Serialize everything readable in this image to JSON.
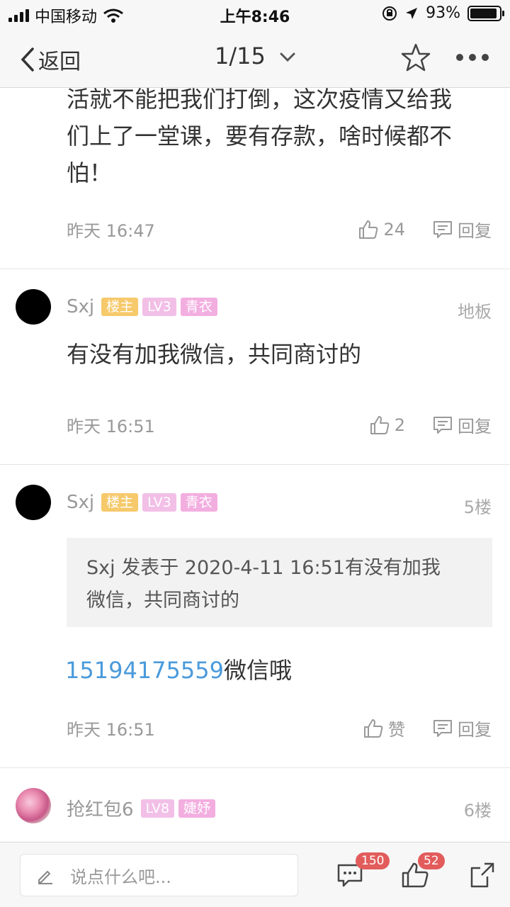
{
  "status_bar": {
    "carrier": "中国移动",
    "time": "上午8:46",
    "battery": "93%",
    "battery_level": 0.93
  },
  "nav": {
    "back_label": "返回",
    "page_indicator": "1/15"
  },
  "posts": [
    {
      "text_lines": [
        "活就不能把我们打倒，这次疫情又给我",
        "们上了一堂课，要有存款，啥时候都不",
        "怕！"
      ],
      "time": "昨天 16:47",
      "likes": "24",
      "reply_label": "回复"
    },
    {
      "username": "Sxj",
      "badges": [
        "楼主",
        "LV3",
        "青衣"
      ],
      "floor": "地板",
      "text": "有没有加我微信，共同商讨的",
      "time": "昨天 16:51",
      "likes": "2",
      "reply_label": "回复"
    },
    {
      "username": "Sxj",
      "badges": [
        "楼主",
        "LV3",
        "青衣"
      ],
      "floor": "5楼",
      "quote_lines": [
        "Sxj 发表于 2020-4-11 16:51有没有加我",
        "微信，共同商讨的"
      ],
      "phone": "15194175559",
      "text_suffix": "微信哦",
      "time": "昨天 16:51",
      "like_label": "赞",
      "reply_label": "回复"
    },
    {
      "username": "抢红包6",
      "badges": [
        "LV8",
        "婕妤"
      ],
      "floor": "6楼"
    }
  ],
  "bottom_bar": {
    "placeholder": "说点什么吧...",
    "comment_count": "150",
    "like_count": "52"
  },
  "colors": {
    "link": "#4a9adb",
    "badge_host": "#f6c96b",
    "badge_level": "#f2bfe7",
    "badge_title": "#f3aee0",
    "count_badge": "#e25c5c"
  }
}
